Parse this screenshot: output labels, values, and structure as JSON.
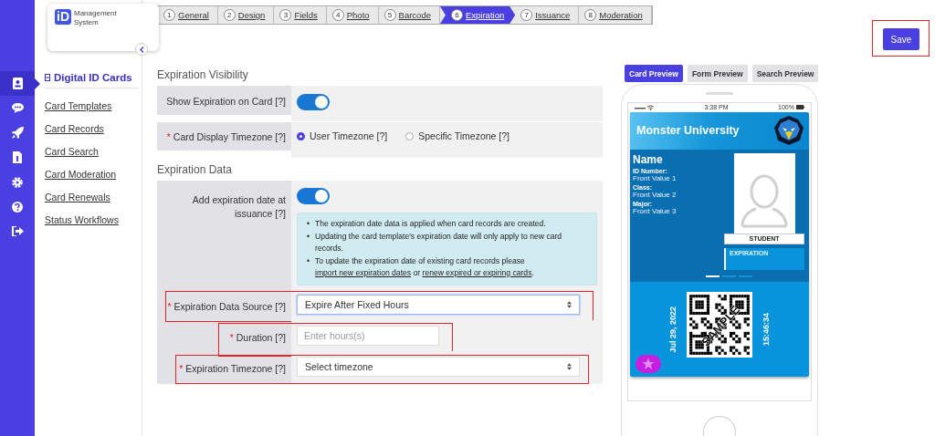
{
  "logo": {
    "badge": "iD",
    "text": "Management System"
  },
  "rail": [
    {
      "selected": true
    },
    {
      "selected": false
    },
    {
      "selected": false
    },
    {
      "selected": false
    },
    {
      "selected": false
    },
    {
      "selected": false
    },
    {
      "selected": false
    }
  ],
  "sidebar": {
    "heading": "Digital ID Cards",
    "items": [
      "Card Templates",
      "Card Records",
      "Card Search",
      "Card Moderation",
      "Card Renewals",
      "Status Workflows"
    ]
  },
  "steps": [
    {
      "number": "1",
      "label": "General",
      "selected": false
    },
    {
      "number": "2",
      "label": "Design",
      "selected": false
    },
    {
      "number": "3",
      "label": "Fields",
      "selected": false
    },
    {
      "number": "4",
      "label": "Photo",
      "selected": false
    },
    {
      "number": "5",
      "label": "Barcode",
      "selected": false
    },
    {
      "number": "6",
      "label": "Expiration",
      "selected": true
    },
    {
      "number": "7",
      "label": "Issuance",
      "selected": false
    },
    {
      "number": "8",
      "label": "Moderation",
      "selected": false
    }
  ],
  "save": {
    "label": "Save",
    "highlighted": true
  },
  "visibility": {
    "title": "Expiration Visibility",
    "show_label": "Show Expiration on Card [?]",
    "show_on": true,
    "timezone_label": "Card Display Timezone [?]",
    "timezone_required_mark": "*",
    "timezone_options": [
      {
        "label": "User Timezone [?]",
        "selected": true
      },
      {
        "label": "Specific Timezone [?]",
        "selected": false
      }
    ]
  },
  "data": {
    "title": "Expiration Data",
    "add_label": "Add expiration date at issuance [?]",
    "add_on": true,
    "notes": [
      {
        "kind": "text",
        "marker": "•",
        "text": "The expiration date data is applied when card records are created."
      },
      {
        "kind": "text",
        "marker": "•",
        "text": "Updating the card template's expiration date will only apply to new card records."
      },
      {
        "kind": "links",
        "marker": "•",
        "before": "To update the expiration date of existing card records please ",
        "link1": "import new expiration dates",
        "middle": " or ",
        "link2": "renew expired or expiring cards",
        "after": "."
      }
    ],
    "fields": [
      {
        "kind": "select",
        "label": "Expiration Data Source [?]",
        "required_mark": "*",
        "value": "Expire After Fixed Hours",
        "highlighted": true
      },
      {
        "kind": "input",
        "label": "Duration [?]",
        "required_mark": "*",
        "placeholder": "Enter hours(s)",
        "highlighted": true
      },
      {
        "kind": "select",
        "label": "Expiration Timezone [?]",
        "required_mark": "*",
        "value": "Select timezone",
        "highlighted": true
      }
    ]
  },
  "preview_tabs": [
    {
      "label": "Card Preview",
      "selected": true
    },
    {
      "label": "Form Preview",
      "selected": false
    },
    {
      "label": "Search Preview",
      "selected": false
    }
  ],
  "phone": {
    "time": "3:38 PM",
    "battery": "100%"
  },
  "card": {
    "school": "Monster University",
    "name": "Name",
    "fields": [
      {
        "label": "ID Number:",
        "value": "Front Value 1"
      },
      {
        "label": "Class:",
        "value": "Front Value 2"
      },
      {
        "label": "Major:",
        "value": "Front Value 3"
      }
    ],
    "role": "STUDENT",
    "expiration_label": "EXPIRATION",
    "date": "Jul 29, 2022",
    "time": "15:46:34",
    "stamp": "SAMPLE"
  }
}
